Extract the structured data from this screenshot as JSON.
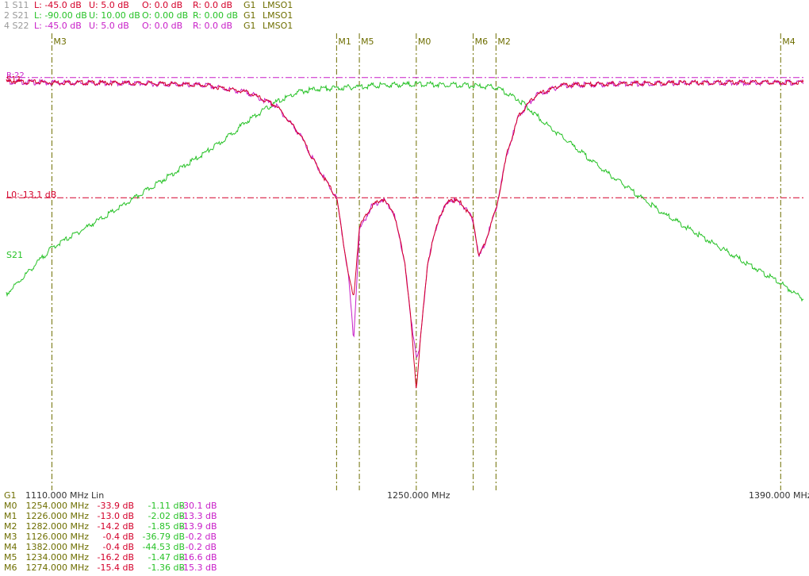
{
  "colors": {
    "s11": "#d4002a",
    "s21": "#27c227",
    "s22": "#c81ec8",
    "marker": "#6e6e00",
    "axis_text": "#333333",
    "dim_text": "#9a9a9a",
    "limit_line": "#d4002a",
    "ref_line": "#c81ec8"
  },
  "header": [
    {
      "id": "1 S11",
      "L": "L: -45.0 dB",
      "U": "U:  5.0 dB",
      "O": "O:  0.0 dB",
      "R": "R:  0.0 dB",
      "G": "G1",
      "mode": "LMSO1",
      "color": "#d4002a"
    },
    {
      "id": "2 S21",
      "L": "L: -90.00 dB",
      "U": "U: 10.00 dB",
      "O": "O:  0.00 dB",
      "R": "R:  0.00 dB",
      "G": "G1",
      "mode": "LMSO1",
      "color": "#27c227"
    },
    {
      "id": "4 S22",
      "L": "L: -45.0 dB",
      "U": "U:  5.0 dB",
      "O": "O:  0.0 dB",
      "R": "R:  0.0 dB",
      "G": "G1",
      "mode": "LMSO1",
      "color": "#c81ec8"
    }
  ],
  "plot": {
    "limit_label": "L0:-13.1 dB",
    "limit_db": -13.1,
    "ref_label": "R:22",
    "s11_label": "S11",
    "s21_label": "S21",
    "markers_top": [
      {
        "name": "M3",
        "freq": 1126
      },
      {
        "name": "M1",
        "freq": 1226
      },
      {
        "name": "M5",
        "freq": 1234
      },
      {
        "name": "M0",
        "freq": 1254
      },
      {
        "name": "M6",
        "freq": 1274
      },
      {
        "name": "M2",
        "freq": 1282
      },
      {
        "name": "M4",
        "freq": 1382
      }
    ]
  },
  "axis": {
    "group": "G1",
    "start_label": "1110.000 MHz Lin",
    "center_label": "1250.000 MHz",
    "stop_label": "1390.000 MHz",
    "start": 1110,
    "stop": 1390
  },
  "marker_table": [
    {
      "name": "M0",
      "freq": "1254.000 MHz",
      "s11": "-33.9 dB",
      "s21": "-1.11 dB",
      "s22": "-30.1 dB"
    },
    {
      "name": "M1",
      "freq": "1226.000 MHz",
      "s11": "-13.0 dB",
      "s21": "-2.02 dB",
      "s22": "-13.3 dB"
    },
    {
      "name": "M2",
      "freq": "1282.000 MHz",
      "s11": "-14.2 dB",
      "s21": "-1.85 dB",
      "s22": "-13.9 dB"
    },
    {
      "name": "M3",
      "freq": "1126.000 MHz",
      "s11": "-0.4 dB",
      "s21": "-36.79 dB",
      "s22": "-0.2 dB"
    },
    {
      "name": "M4",
      "freq": "1382.000 MHz",
      "s11": "-0.4 dB",
      "s21": "-44.53 dB",
      "s22": "-0.2 dB"
    },
    {
      "name": "M5",
      "freq": "1234.000 MHz",
      "s11": "-16.2 dB",
      "s21": "-1.47 dB",
      "s22": "-16.6 dB"
    },
    {
      "name": "M6",
      "freq": "1274.000 MHz",
      "s11": "-15.4 dB",
      "s21": "-1.36 dB",
      "s22": "-15.3 dB"
    }
  ]
}
